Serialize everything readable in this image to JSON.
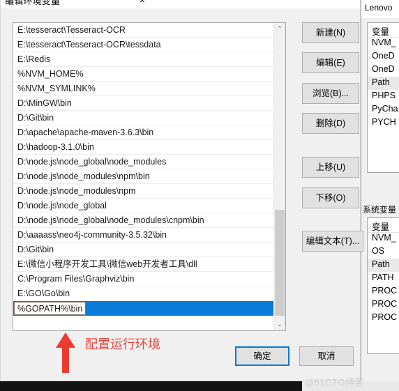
{
  "dialog": {
    "title": "编辑环境变量",
    "close_icon": "×",
    "list_items": [
      "E:\\tesseract\\Tesseract-OCR",
      "E:\\tesseract\\Tesseract-OCR\\tessdata",
      "E:\\Redis",
      "%NVM_HOME%",
      "%NVM_SYMLINK%",
      "D:\\MinGW\\bin",
      "D:\\Git\\bin",
      "D:\\apache\\apache-maven-3.6.3\\bin",
      "D:\\hadoop-3.1.0\\bin",
      "D:\\node.js\\node_global\\node_modules",
      "D:\\node.js\\node_modules\\npm\\bin",
      "D:\\node.js\\node_modules\\npm",
      "D:\\node.js\\node_global",
      "D:\\node.js\\node_global\\node_modules\\cnpm\\bin",
      "D:\\aaaass\\neo4j-community-3.5.32\\bin",
      "D:\\Git\\bin",
      "E:\\微信小程序开发工具\\微信web开发者工具\\dll",
      "C:\\Program Files\\Graphviz\\bin",
      "E:\\GO\\Go\\bin"
    ],
    "selected_item_value": "%GOPATH%\\bin",
    "buttons": {
      "new": "新建(N)",
      "edit": "编辑(E)",
      "browse": "浏览(B)...",
      "delete": "删除(D)",
      "move_up": "上移(U)",
      "move_down": "下移(O)",
      "edit_text": "编辑文本(T)...",
      "ok": "确定",
      "cancel": "取消"
    },
    "scrollbar": {
      "up_arrow": "⌃",
      "down_arrow": "⌄"
    }
  },
  "annotation": {
    "text": "配置运行环境",
    "color": "#e8453c"
  },
  "background_window": {
    "title": "Lenovo",
    "user_vars": {
      "column_header": "变量",
      "rows": [
        "NVM_",
        "OneD",
        "OneD",
        "Path",
        "PHPS",
        "PyCha",
        "PYCH"
      ],
      "selected_index": 3
    },
    "system_vars_label": "系统变量",
    "system_vars": {
      "column_header": "变量",
      "rows": [
        "NVM_",
        "OS",
        "Path",
        "PATH",
        "PROC",
        "PROC",
        "PROC"
      ],
      "selected_index": 2
    }
  },
  "watermark": "@51CTO博客",
  "colors": {
    "selection_blue": "#0a7bd6",
    "focus_blue": "#0078d7",
    "annotation_red": "#e8453c"
  }
}
